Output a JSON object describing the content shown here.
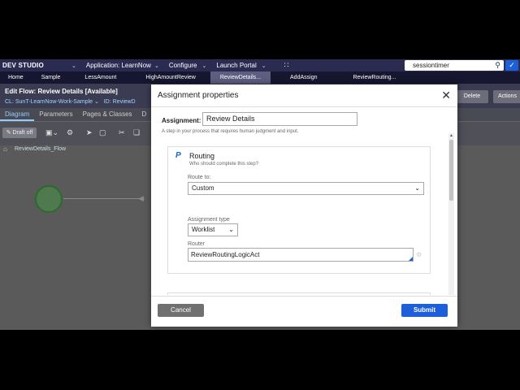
{
  "header": {
    "brand": "DEV STUDIO",
    "application_label": "Application:",
    "application_value": "LearnNow",
    "configure": "Configure",
    "launch_portal": "Launch Portal",
    "search_value": "sessiontimer"
  },
  "tabs": [
    "Home",
    "Sample",
    "LessAmount",
    "HighAmountReview",
    "ReviewDetails...",
    "AddAssign",
    "ReviewRouting..."
  ],
  "rule": {
    "title": "Edit  Flow: Review Details [Available]",
    "cl_label": "CL:",
    "cl_value": "SunT-LearnNow-Work-Sample",
    "id_label": "ID:",
    "id_value": "ReviewD",
    "delete": "Delete",
    "actions": "Actions"
  },
  "subtabs": [
    "Diagram",
    "Parameters",
    "Pages & Classes",
    "D"
  ],
  "toolbar": {
    "draft": "Draft off"
  },
  "breadcrumb": "ReviewDetails_Flow",
  "modal": {
    "title": "Assignment properties",
    "assignment_label": "Assignment:",
    "assignment_value": "Review Details",
    "assignment_hint": "A step in your process that requires human judgment and input.",
    "routing_title": "Routing",
    "routing_sub": "Who should complete this step?",
    "route_to_label": "Route to:",
    "route_to_value": "Custom",
    "assignment_type_label": "Assignment type",
    "assignment_type_value": "Worklist",
    "router_label": "Router",
    "router_value": "ReviewRoutingLogicAct",
    "cancel": "Cancel",
    "submit": "Submit"
  },
  "icons": {
    "search": "search-icon",
    "close": "close-icon",
    "chevron": "chevron-down-icon"
  },
  "colors": {
    "header_bg": "#2b2b52",
    "primary": "#1c5fd9",
    "cancel": "#707070"
  }
}
